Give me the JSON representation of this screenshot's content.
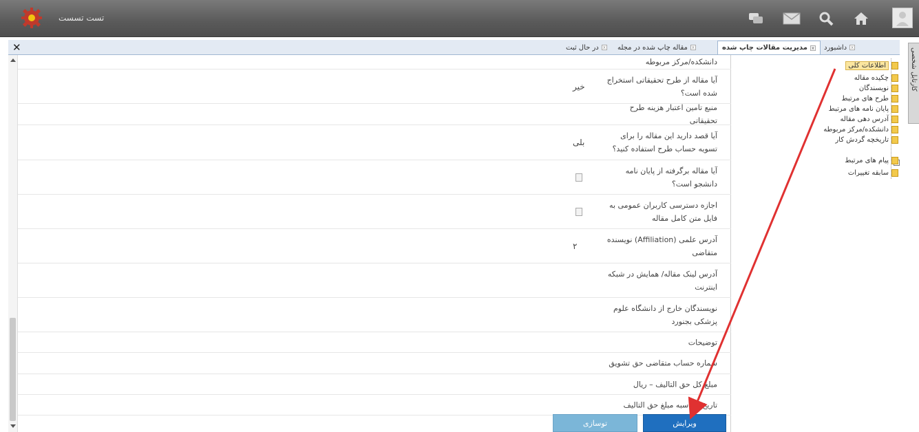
{
  "header": {
    "app_title": "تست تسست",
    "icons": [
      "chat-icon",
      "mail-icon",
      "search-icon",
      "home-icon"
    ]
  },
  "side_tab": {
    "label": "کارتابل شخصی"
  },
  "tabs": [
    {
      "label": "داشبورد",
      "active": false
    },
    {
      "label": "مدیریت مقالات چاپ شده",
      "active": true
    },
    {
      "label": "مقاله چاپ شده در مجله",
      "active": false
    },
    {
      "label": "در حال ثبت",
      "active": false
    }
  ],
  "form_rows": [
    {
      "label": "دانشکده/مرکز مربوطه",
      "value": "",
      "type": "text"
    },
    {
      "label": "آیا مقاله از طرح تحقیقاتی استخراج شده است؟",
      "value": "خیر",
      "type": "text"
    },
    {
      "label": "منبع تامین اعتبار هزینه طرح تحقیقاتی",
      "value": "",
      "type": "text"
    },
    {
      "label": "آیا قصد دارید این مقاله را برای تسویه حساب طرح استفاده کنید؟",
      "value": "بلی",
      "type": "text"
    },
    {
      "label": "آیا مقاله برگرفته از پایان نامه دانشجو است؟",
      "value": "",
      "type": "checkbox"
    },
    {
      "label": "اجازه دسترسی کاربران عمومی به فایل متن کامل مقاله",
      "value": "",
      "type": "checkbox"
    },
    {
      "label": "آدرس علمی (Affiliation) نویسنده متقاضی",
      "value": "۲",
      "type": "text"
    },
    {
      "label": "آدرس لینک مقاله/ همایش در شبکه اینترنت",
      "value": "",
      "type": "text"
    },
    {
      "label": "نویسندگان خارج از دانشگاه علوم پزشکی بجنورد",
      "value": "",
      "type": "text"
    },
    {
      "label": "توضیحات",
      "value": "",
      "type": "text"
    },
    {
      "label": "شماره حساب متقاضی حق تشویق",
      "value": "",
      "type": "text"
    },
    {
      "label": "مبلغ کل حق التالیف – ریال",
      "value": "",
      "type": "text"
    },
    {
      "label": "تاریخ محاسبه مبلغ حق التالیف",
      "value": "",
      "type": "text"
    }
  ],
  "buttons": {
    "edit": "ویرایش",
    "cancel": "توسازی"
  },
  "tree": [
    {
      "label": "اطلاعات کلی",
      "selected": true
    },
    {
      "label": "چکیده مقاله",
      "selected": false
    },
    {
      "label": "نویسندگان",
      "selected": false
    },
    {
      "label": "طرح های مرتبط",
      "selected": false
    },
    {
      "label": "پایان نامه های مرتبط",
      "selected": false
    },
    {
      "label": "آدرس دهی مقاله",
      "selected": false
    },
    {
      "label": "دانشکده/مرکز مربوطه",
      "selected": false
    },
    {
      "label": "تاریخچه گردش کار",
      "selected": false
    },
    {
      "label": "پیام های مرتبط",
      "selected": false
    },
    {
      "label": "سابقه تغییرات",
      "selected": false
    }
  ],
  "colors": {
    "accent": "#1f6fbf",
    "annotation_arrow": "#e03131"
  }
}
